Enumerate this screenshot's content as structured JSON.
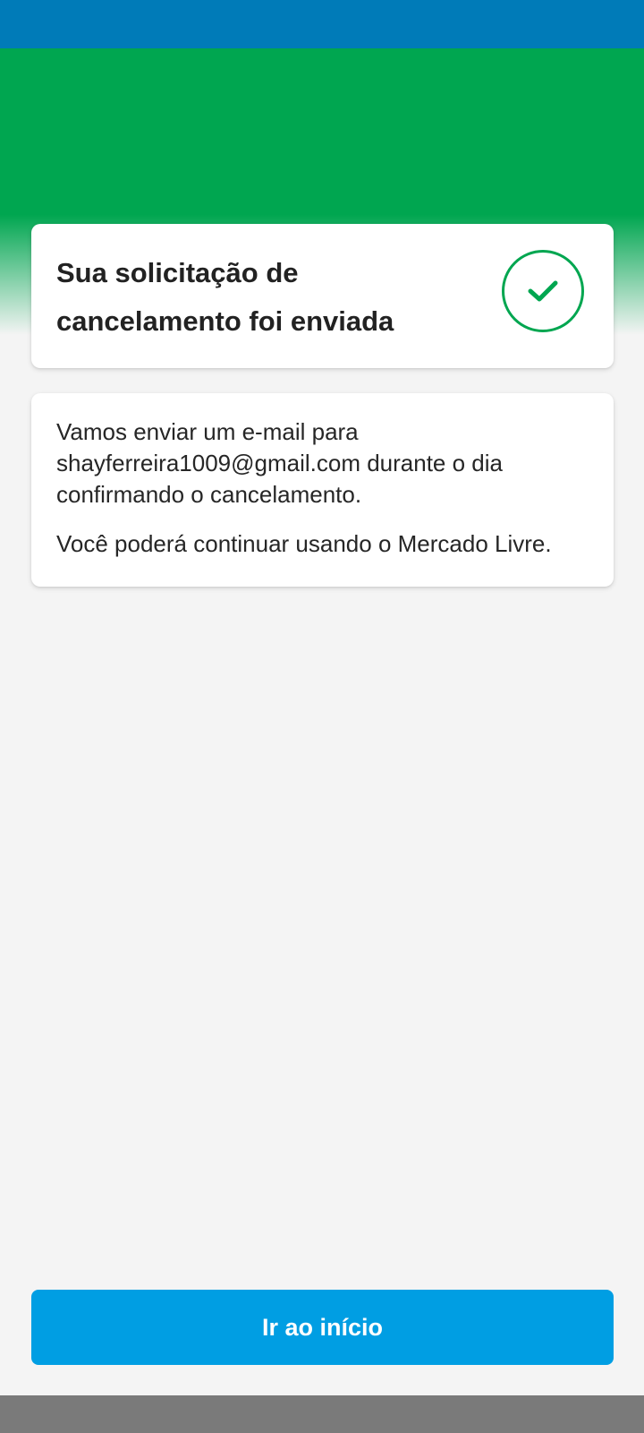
{
  "colors": {
    "status_bar": "#007bb8",
    "hero_green": "#00a650",
    "background": "#f4f4f4",
    "success_green": "#00a650",
    "button_blue": "#009ee3",
    "nav_bar": "#7a7a7a"
  },
  "confirmation": {
    "title": "Sua solicitação de cancelamento foi enviada",
    "icon": "check-icon"
  },
  "info": {
    "email_message": "Vamos enviar um e-mail para shayferreira1009@gmail.com durante o dia confirmando o cancelamento.",
    "continue_message": "Você poderá continuar usando o Mercado Livre."
  },
  "actions": {
    "home_button_label": "Ir ao início"
  }
}
